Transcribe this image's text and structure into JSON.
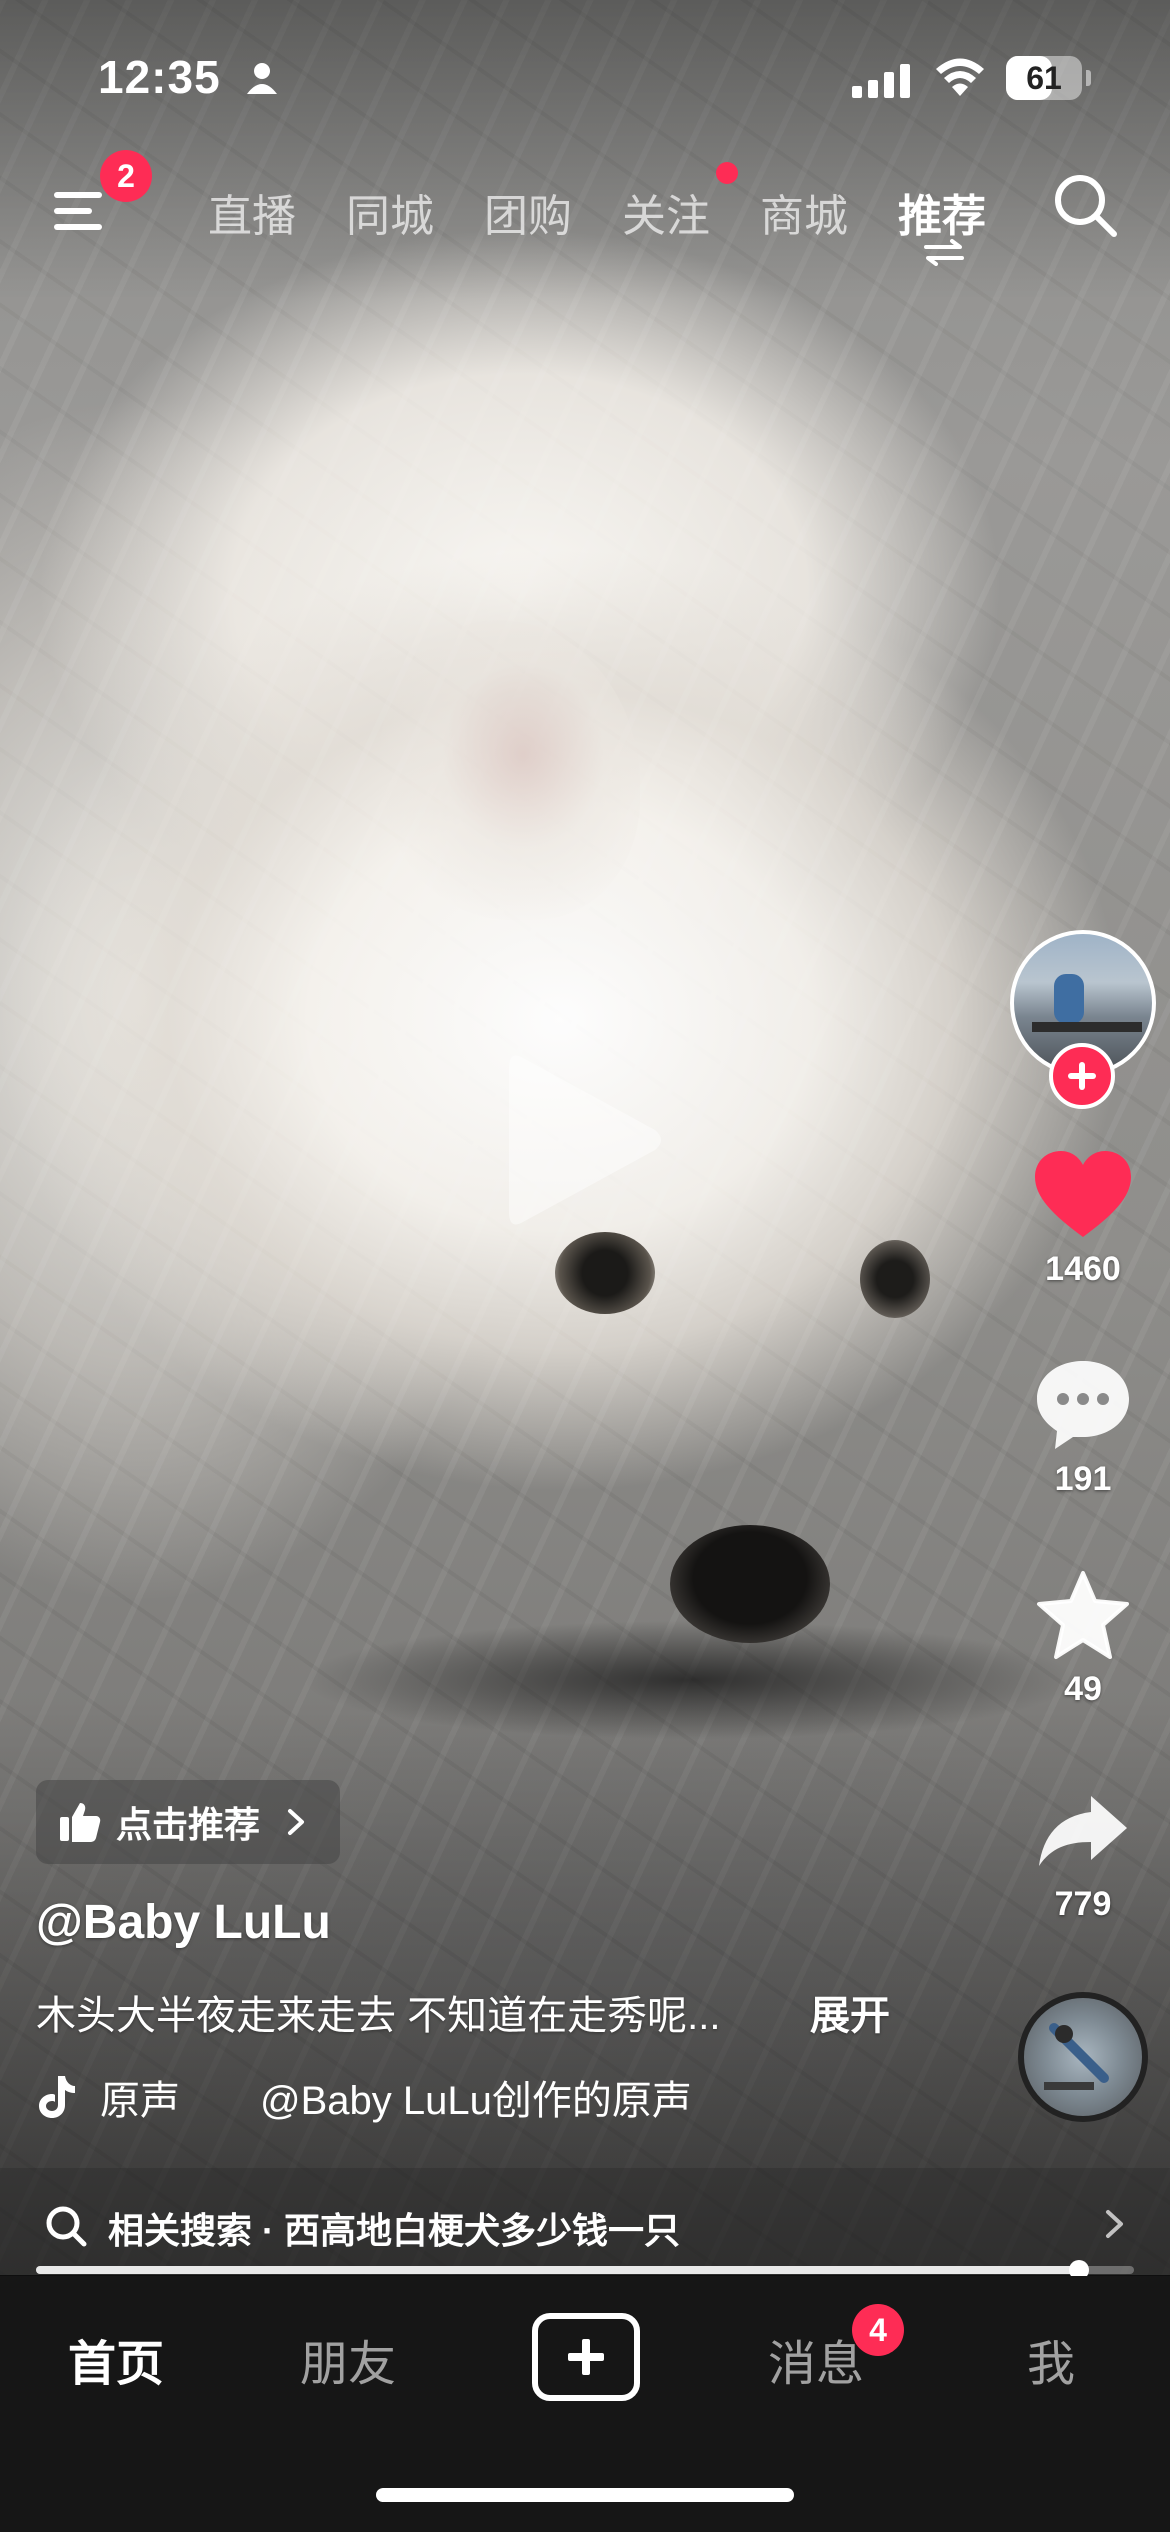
{
  "status_bar": {
    "time": "12:35",
    "battery": "61",
    "battery_level": 0.61
  },
  "top_nav": {
    "menu_badge": "2",
    "tabs": [
      {
        "label": "直播",
        "active": false
      },
      {
        "label": "同城",
        "active": false
      },
      {
        "label": "团购",
        "active": false
      },
      {
        "label": "关注",
        "active": false,
        "has_dot": true
      },
      {
        "label": "商城",
        "active": false
      },
      {
        "label": "推荐",
        "active": true
      }
    ]
  },
  "video": {
    "recommend_label": "点击推荐",
    "author": "@Baby LuLu",
    "description": "木头大半夜走来走去 不知道在走秀呢...",
    "expand_label": "展开",
    "music": "原声　　@Baby LuLu创作的原声",
    "progress": 0.95
  },
  "actions": {
    "likes": "1460",
    "comments": "191",
    "favorites": "49",
    "shares": "779"
  },
  "related_search": {
    "text": "相关搜索 · 西高地白梗犬多少钱一只"
  },
  "tab_bar": {
    "items": [
      {
        "label": "首页",
        "active": true
      },
      {
        "label": "朋友",
        "active": false
      },
      {
        "label": "消息",
        "active": false,
        "badge": "4"
      },
      {
        "label": "我",
        "active": false
      }
    ]
  },
  "colors": {
    "accent": "#fe2c55",
    "tab_bar_bg": "#161616"
  },
  "icons": [
    "menu-icon",
    "search-icon",
    "switch-icon",
    "play-icon",
    "heart-icon",
    "comment-icon",
    "star-icon",
    "share-icon",
    "thumbs-up-icon",
    "tiktok-note-icon",
    "chevron-right-icon",
    "plus-icon"
  ]
}
